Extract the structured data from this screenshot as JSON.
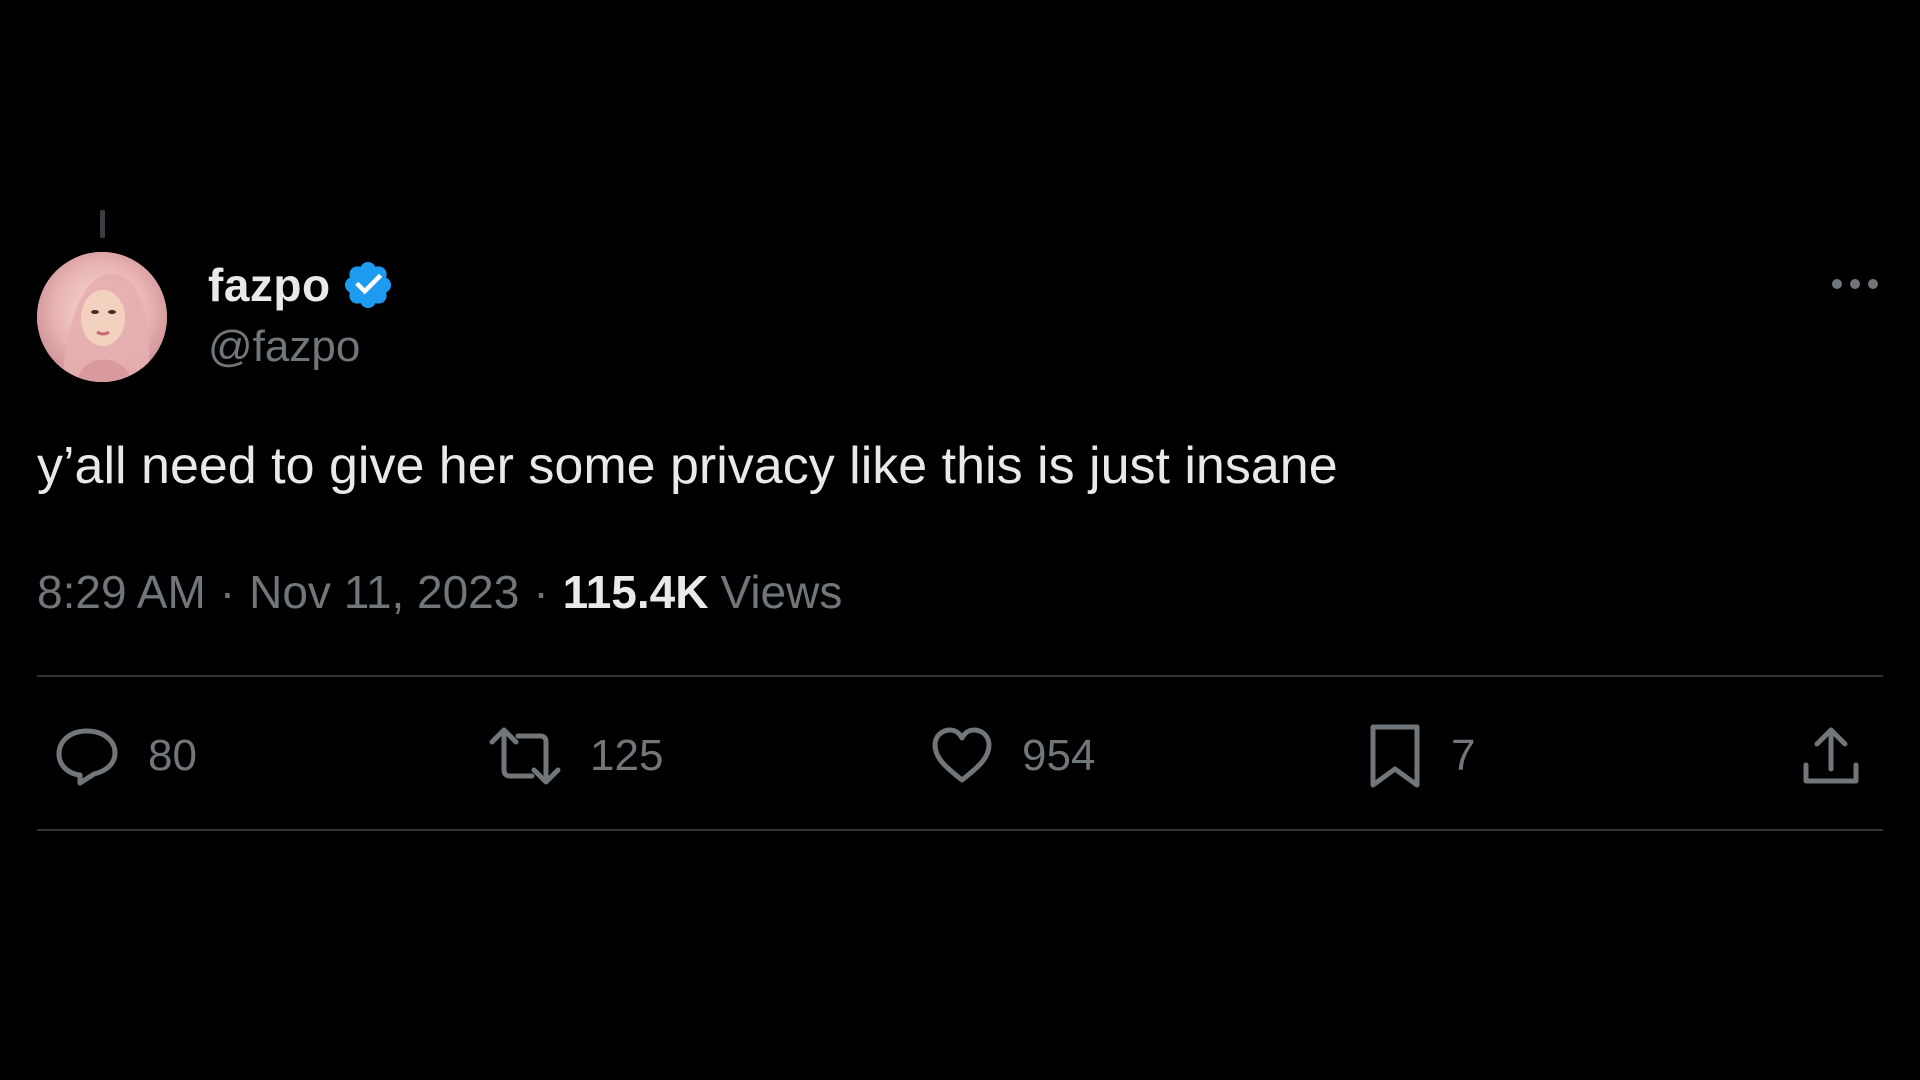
{
  "tweet": {
    "display_name": "fazpo",
    "handle": "@fazpo",
    "text": "y’all need to give her some privacy like this is just insane",
    "time": "8:29 AM",
    "separator": "·",
    "date": "Nov 11, 2023",
    "views_count": "115.4K",
    "views_label": "Views"
  },
  "actions": {
    "replies": "80",
    "reposts": "125",
    "likes": "954",
    "bookmarks": "7"
  },
  "icons": {
    "verified": "verified-badge-icon",
    "more": "more-horizontal-icon",
    "reply": "reply-icon",
    "repost": "repost-icon",
    "like": "heart-icon",
    "bookmark": "bookmark-icon",
    "share": "share-icon"
  },
  "colors": {
    "background": "#000000",
    "primary_text": "#e7e9ea",
    "secondary_text": "#71767b",
    "verified_blue": "#1d9bf0",
    "divider": "#2f3336"
  }
}
